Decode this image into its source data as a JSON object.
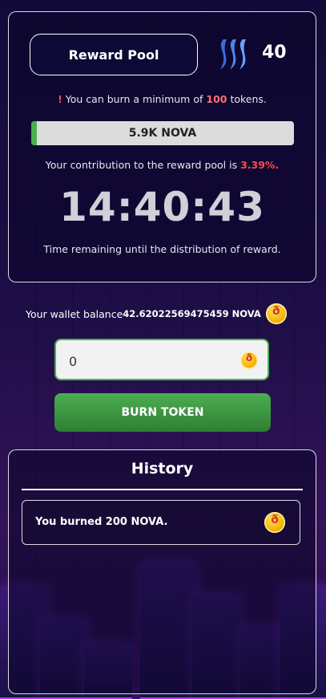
{
  "reward_pool": {
    "title": "Reward Pool",
    "participant_count": "40",
    "min_note_prefix": "You can burn a minimum of",
    "min_amount": "100",
    "min_note_suffix": "tokens.",
    "progress_label": "5.9K NOVA",
    "progress_fraction": 0.02,
    "contribution_prefix": "Your contribution to the reward pool is",
    "contribution_pct": "3.39%.",
    "timer": "14:40:43",
    "time_note": "Time remaining until the distribution of reward."
  },
  "wallet": {
    "label": "Your wallet balance",
    "amount": "42.62022569475459 NOVA"
  },
  "burn": {
    "input_value": "0",
    "button_label": "BURN TOKEN"
  },
  "history": {
    "title": "History",
    "items": [
      {
        "text": "You burned 200 NOVA."
      }
    ]
  },
  "colors": {
    "accent_green": "#4caf50",
    "highlight_red": "#ff4b4b",
    "coin_gold": "#f3b300"
  },
  "icons": {
    "brand": "steem-logo-icon",
    "token": "nova-coin-icon"
  }
}
